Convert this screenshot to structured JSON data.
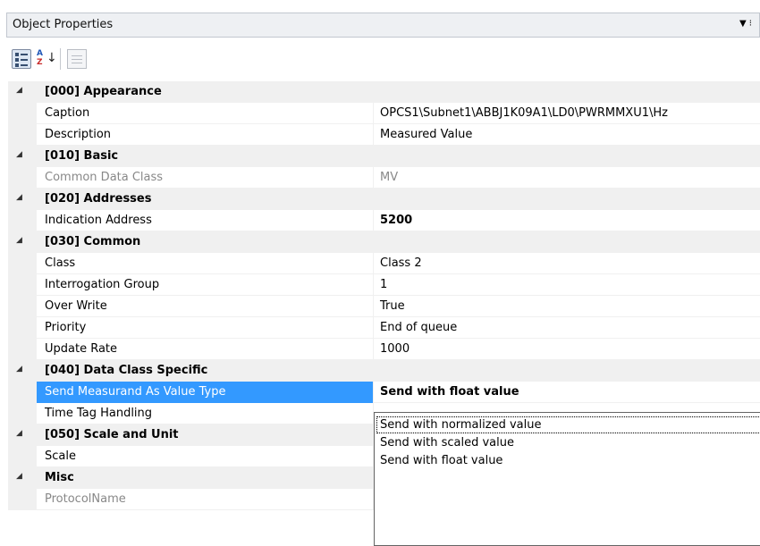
{
  "header": {
    "title": "Object Properties",
    "pin_icon": "pin-icon"
  },
  "toolbar": {
    "categorized_icon": "categorized-icon",
    "alphabetical_icon": "alphabetical-icon",
    "property_pages_icon": "property-pages-icon"
  },
  "grid": {
    "c0": "[000] Appearance",
    "r_caption": {
      "name": "Caption",
      "value": "OPCS1\\Subnet1\\ABBJ1K09A1\\LD0\\PWRMMXU1\\Hz"
    },
    "r_description": {
      "name": "Description",
      "value": "Measured Value"
    },
    "c1": "[010] Basic",
    "r_cdc": {
      "name": "Common Data Class",
      "value": "MV"
    },
    "c2": "[020] Addresses",
    "r_ind": {
      "name": "Indication Address",
      "value": "5200"
    },
    "c3": "[030] Common",
    "r_class": {
      "name": "Class",
      "value": "Class 2"
    },
    "r_ig": {
      "name": "Interrogation Group",
      "value": "1"
    },
    "r_ow": {
      "name": "Over Write",
      "value": "True"
    },
    "r_prio": {
      "name": "Priority",
      "value": "End of queue"
    },
    "r_ur": {
      "name": "Update Rate",
      "value": "1000"
    },
    "c4": "[040] Data Class Specific",
    "r_smav": {
      "name": "Send Measurand As Value Type",
      "value": "Send with float value"
    },
    "r_tth": {
      "name": "Time Tag Handling",
      "value": ""
    },
    "c5": "[050] Scale and Unit",
    "r_scale": {
      "name": "Scale",
      "value": ""
    },
    "c6": "Misc",
    "r_pn": {
      "name": "ProtocolName",
      "value": ""
    }
  },
  "dropdown": {
    "options": [
      "Send with normalized value",
      "Send with scaled value",
      "Send with float value"
    ]
  },
  "colors": {
    "selection": "#3399ff",
    "category_bg": "#f0f0f0"
  }
}
